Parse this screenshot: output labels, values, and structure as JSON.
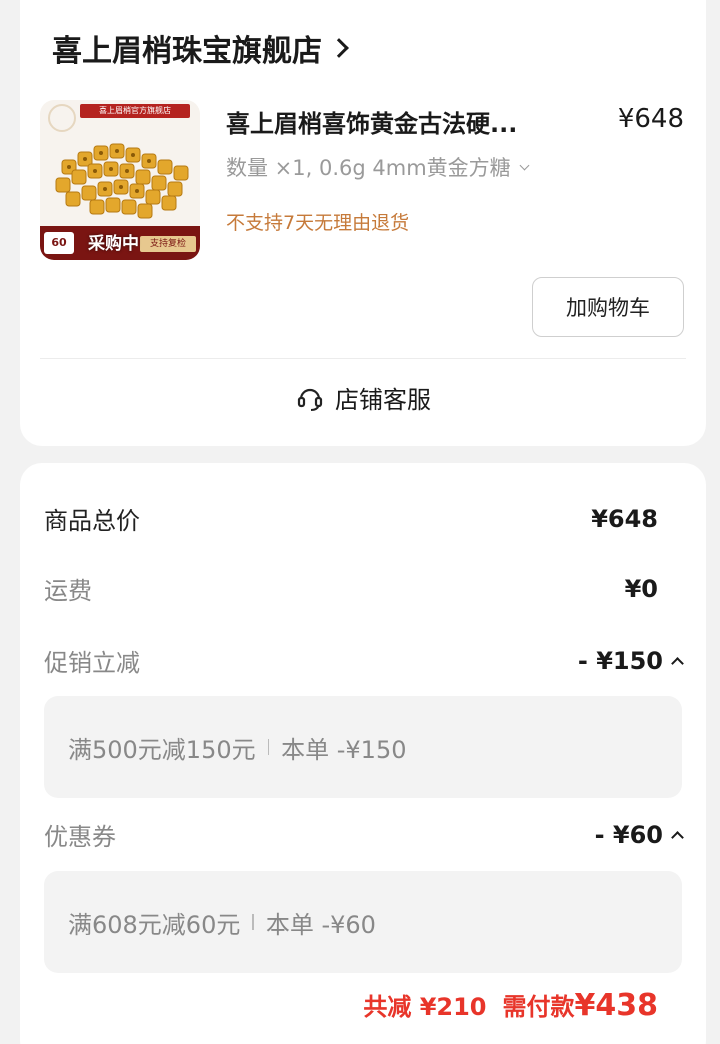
{
  "store": {
    "name": "喜上眉梢珠宝旗舰店"
  },
  "item": {
    "thumb_banner": "喜上眉梢官方旗舰店",
    "thumb_price": "60",
    "thumb_tag": "支持复检",
    "thumb_status": "采购中",
    "title": "喜上眉梢喜饰黄金古法硬...",
    "price": "¥648",
    "spec": "数量 ×1, 0.6g 4mm黄金方糖",
    "return_policy": "不支持7天无理由退货",
    "add_cart_label": "加购物车"
  },
  "service": {
    "label": "店铺客服"
  },
  "summary": {
    "total_label": "商品总价",
    "total_value": "¥648",
    "shipping_label": "运费",
    "shipping_value": "¥0",
    "promo_label": "促销立减",
    "promo_value": "- ¥150",
    "promo_detail_rule": "满500元减150元",
    "promo_detail_amount": "本单 -¥150",
    "coupon_label": "优惠券",
    "coupon_value": "- ¥60",
    "coupon_detail_rule": "满608元减60元",
    "coupon_detail_amount": "本单 -¥60",
    "reduce_total": "共减 ¥210",
    "pay_label": "需付款",
    "pay_amount": "¥438"
  },
  "colors": {
    "accent_red": "#e8352a",
    "policy_orange": "#c67a3a"
  }
}
